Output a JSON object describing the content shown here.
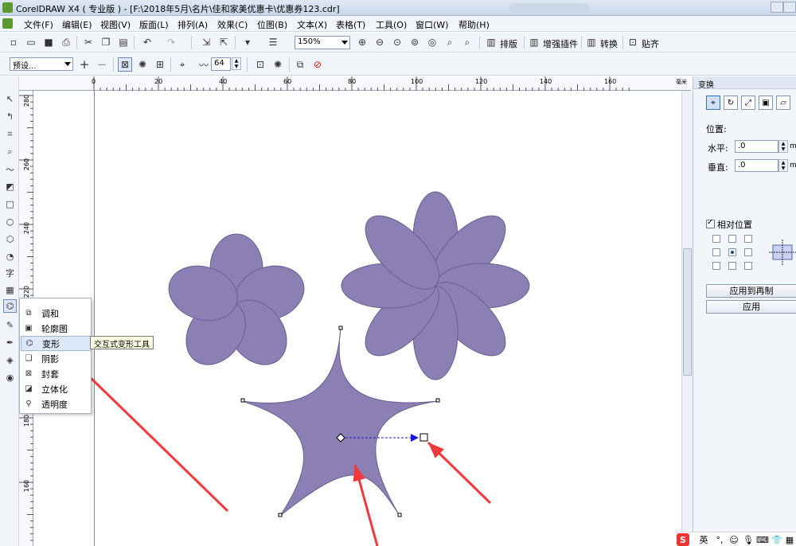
{
  "title": "CorelDRAW X4 ( 专业版 ) - [F:\\2018年5月\\名片\\佳和家美优惠卡\\优惠券123.cdr]",
  "menu": [
    "文件(F)",
    "编辑(E)",
    "视图(V)",
    "版面(L)",
    "排列(A)",
    "效果(C)",
    "位图(B)",
    "文本(X)",
    "表格(T)",
    "工具(O)",
    "窗口(W)",
    "帮助(H)"
  ],
  "toolbar1": {
    "zoom": "150%",
    "buttons": [
      "排版",
      "增强插件",
      "转换",
      "贴齐"
    ]
  },
  "toolbar2": {
    "preset": "预设...",
    "amplitude": "64"
  },
  "ruler": {
    "top_labels": [
      "0",
      "20",
      "40",
      "60",
      "80",
      "100",
      "120",
      "140",
      "160"
    ],
    "unit": "毫米",
    "left_labels": [
      "280",
      "260",
      "240",
      "220",
      "180",
      "160"
    ]
  },
  "docker": {
    "title": "变换",
    "position_label": "位置:",
    "h_label": "水平:",
    "h_value": ".0",
    "v_label": "垂直:",
    "v_value": ".0",
    "unit": "mm",
    "relative_label": "相对位置",
    "apply_dup": "应用到再制",
    "apply": "应用"
  },
  "flyout": {
    "items": [
      "调和",
      "轮廓图",
      "变形",
      "阴影",
      "封套",
      "立体化",
      "透明度"
    ]
  },
  "tooltip": "交互式变形工具",
  "tray": {
    "lang": "英",
    "logo": "S"
  },
  "colors": {
    "shape_fill": "#8c7fb4",
    "shape_stroke": "#6a5f8e",
    "arrow": "#f2383a"
  }
}
